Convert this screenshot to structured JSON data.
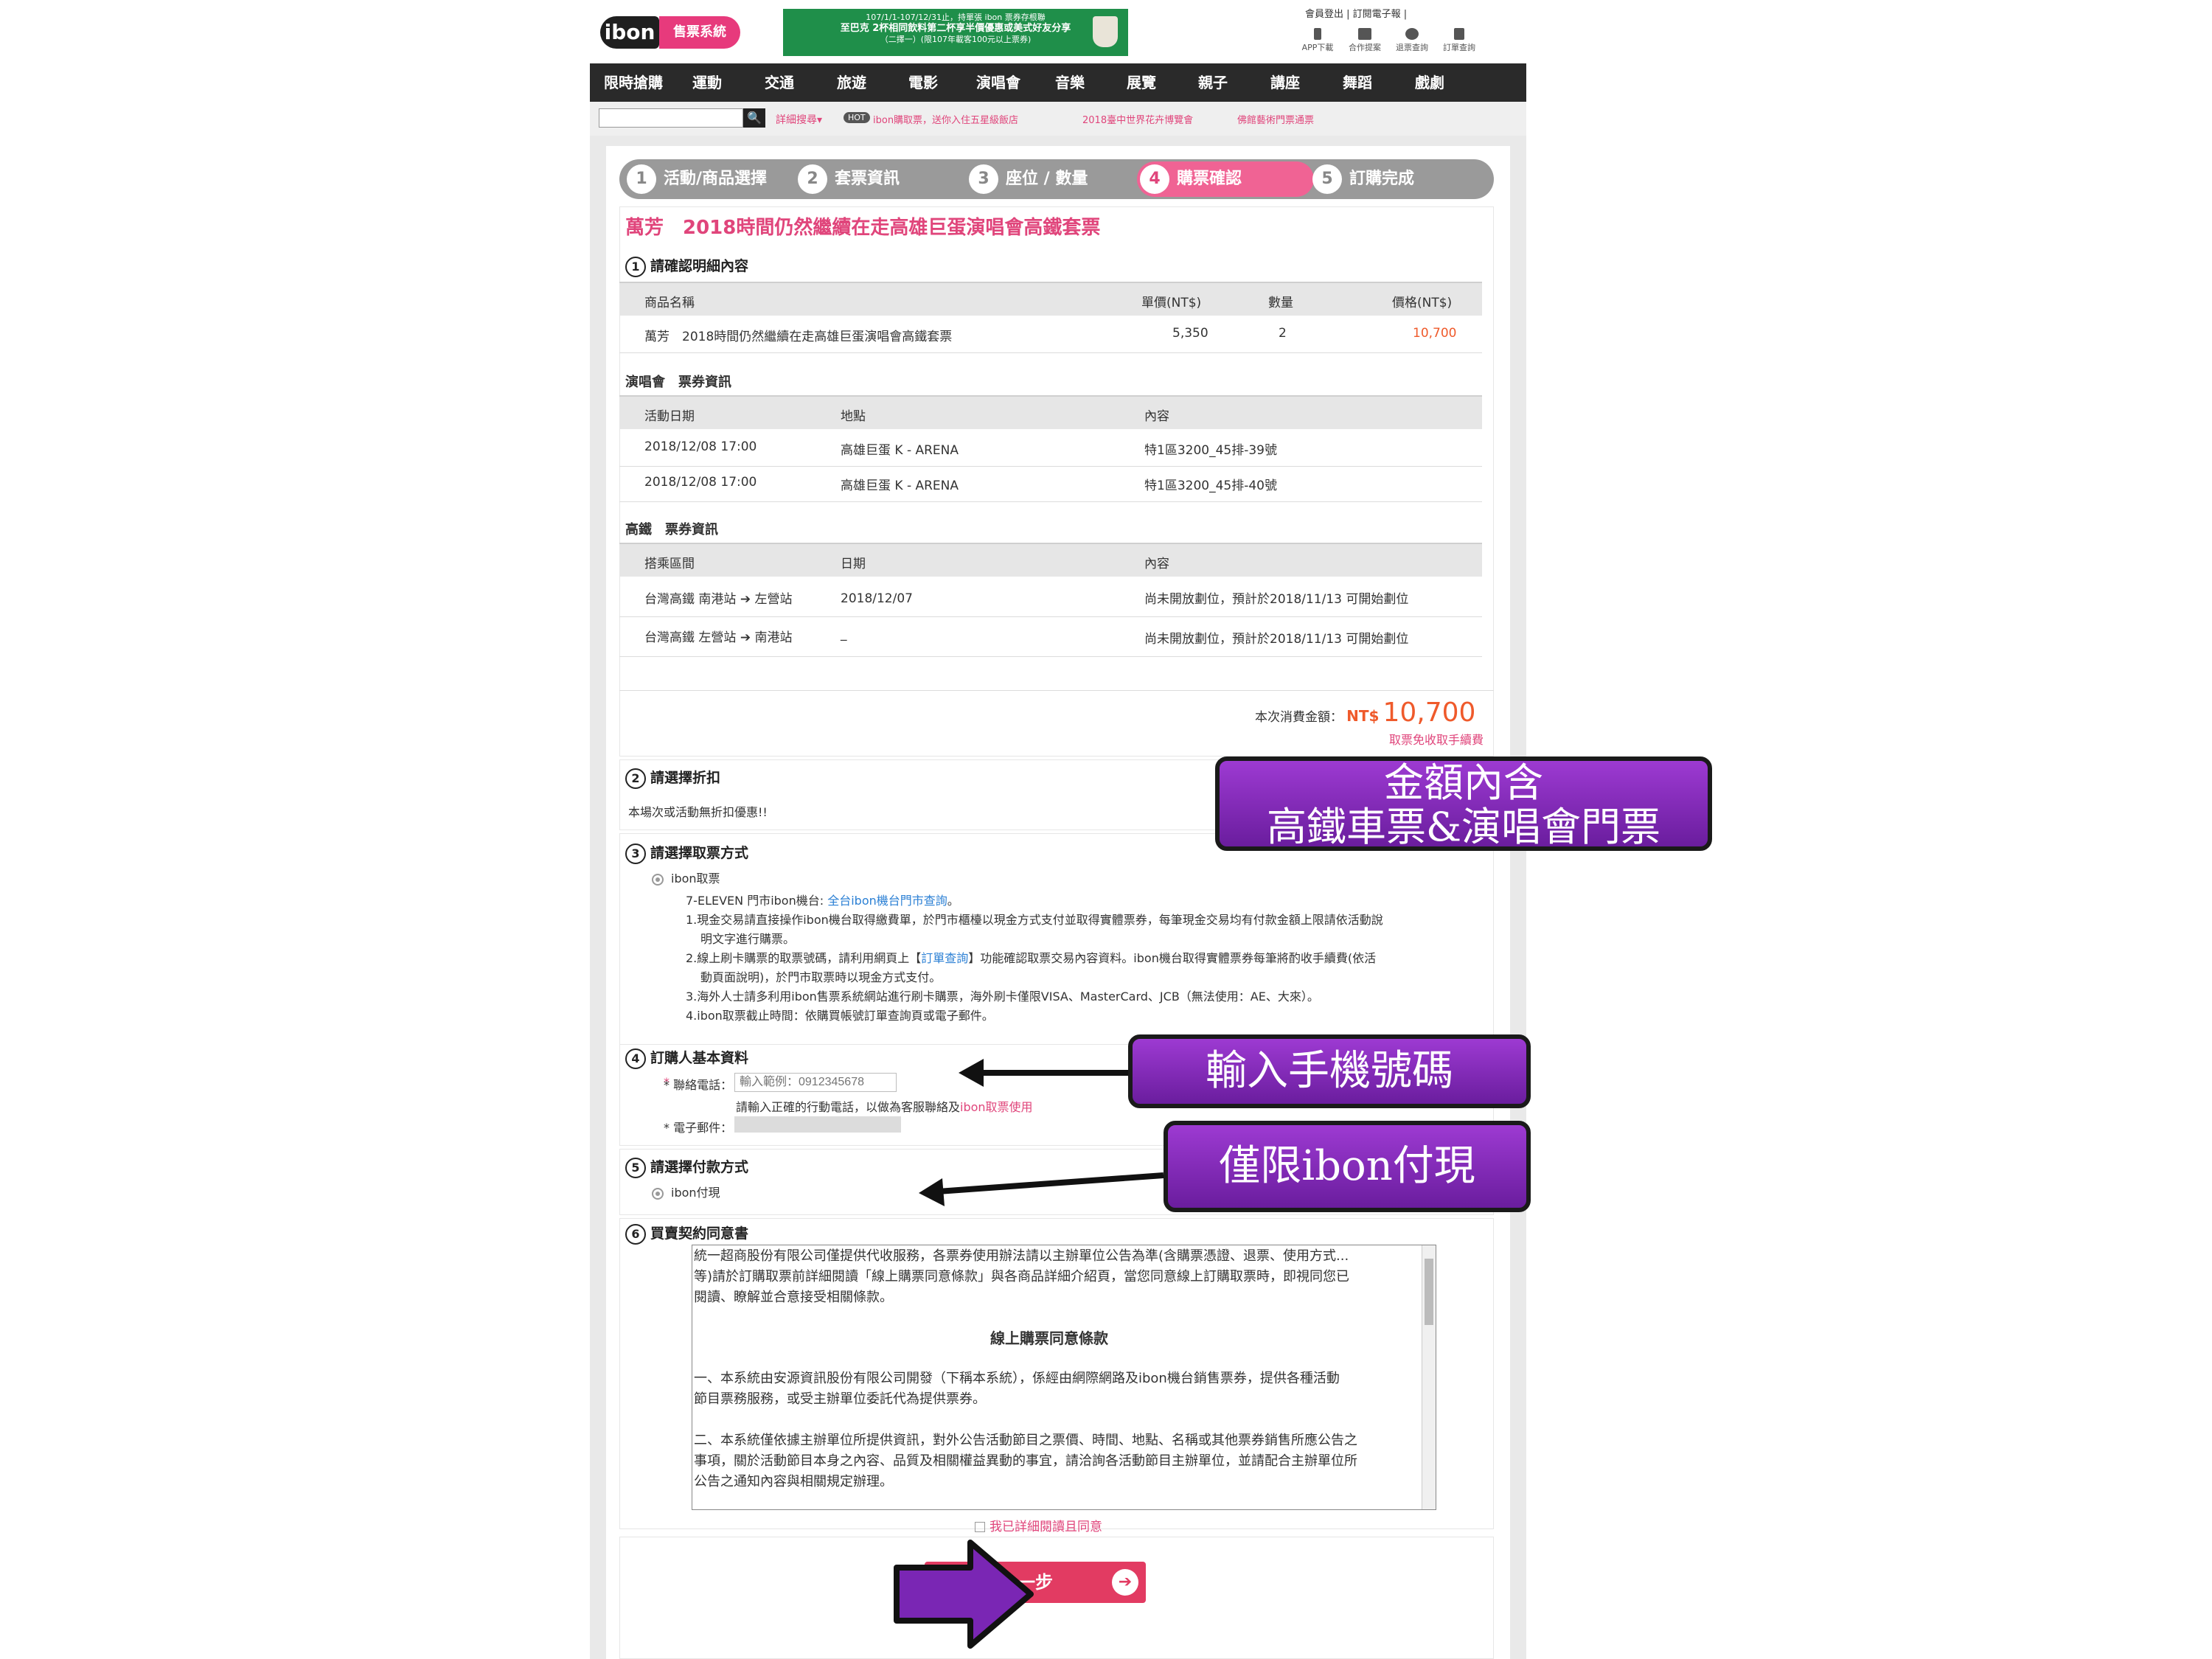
{
  "header": {
    "logo": "ibon",
    "logo_sub": "售票系統",
    "banner": {
      "line1": "107/1/1-107/12/31止，持單張 ibon 票券存根聯",
      "line2": "至巴克 2杯相同飲料第二杯享半價優惠或美式好友分享",
      "line3": "（二擇一）(限107年載客100元以上票券)"
    },
    "top_links": "會員登出 | 訂閱電子報 |",
    "tools": [
      {
        "label": "APP下載",
        "icon": "phone-icon"
      },
      {
        "label": "合作提案",
        "icon": "briefcase-icon"
      },
      {
        "label": "退票查詢",
        "icon": "refund-icon"
      },
      {
        "label": "訂單查詢",
        "icon": "document-icon"
      }
    ]
  },
  "nav": [
    "限時搶購",
    "運動",
    "交通",
    "旅遊",
    "電影",
    "演唱會",
    "音樂",
    "展覽",
    "親子",
    "講座",
    "舞蹈",
    "戲劇"
  ],
  "search": {
    "placeholder": "",
    "button": "🔍",
    "advanced": "詳細搜尋▾",
    "hot_badge": "HOT",
    "hot_links": [
      "ibon購取票，送你入住五星級飯店",
      "2018臺中世界花卉博覽會",
      "佛館藝術門票通票"
    ]
  },
  "steps": [
    {
      "num": "1",
      "label": "活動/商品選擇"
    },
    {
      "num": "2",
      "label": "套票資訊"
    },
    {
      "num": "3",
      "label": "座位 / 數量"
    },
    {
      "num": "4",
      "label": "購票確認"
    },
    {
      "num": "5",
      "label": "訂購完成"
    }
  ],
  "event_title": "萬芳　2018時間仍然繼續在走高雄巨蛋演唱會高鐵套票",
  "section1": {
    "num": "1",
    "title": "請確認明細內容",
    "headers": [
      "商品名稱",
      "單價(NT$)",
      "數量",
      "價格(NT$)"
    ],
    "row": {
      "name": "萬芳　2018時間仍然繼續在走高雄巨蛋演唱會高鐵套票",
      "unit_price": "5,350",
      "qty": "2",
      "price": "10,700"
    }
  },
  "concert": {
    "title": "演唱會　票券資訊",
    "headers": [
      "活動日期",
      "地點",
      "內容"
    ],
    "rows": [
      {
        "date": "2018/12/08 17:00",
        "venue": "高雄巨蛋 K - ARENA",
        "content": "特1區3200_45排-39號"
      },
      {
        "date": "2018/12/08 17:00",
        "venue": "高雄巨蛋 K - ARENA",
        "content": "特1區3200_45排-40號"
      }
    ]
  },
  "hsr": {
    "title": "高鐵　票券資訊",
    "headers": [
      "搭乘區間",
      "日期",
      "內容"
    ],
    "rows": [
      {
        "from": "台灣高鐵 南港站",
        "to": "左營站",
        "date": "2018/12/07",
        "content": "尚未開放劃位，預計於2018/11/13 可開始劃位"
      },
      {
        "from": "台灣高鐵 左營站",
        "to": "南港站",
        "date": "_",
        "content": "尚未開放劃位，預計於2018/11/13 可開始劃位"
      }
    ]
  },
  "total": {
    "label": "本次消費金額：",
    "currency": "NT$",
    "value": "10,700",
    "note": "取票免收取手續費"
  },
  "section2": {
    "num": "2",
    "title": "請選擇折扣",
    "note": "本場次或活動無折扣優惠!!"
  },
  "section3": {
    "num": "3",
    "title": "請選擇取票方式",
    "option": "ibon取票",
    "line0a": "7-ELEVEN 門市ibon機台: ",
    "line0b": "全台ibon機台門市查詢",
    "line0c": "。",
    "line1": "1.現金交易請直接操作ibon機台取得繳費單，於門市櫃檯以現金方式支付並取得實體票券，每筆現金交易均有付款金額上限請依活動說",
    "line1b": "明文字進行購票。",
    "line2a": "2.線上刷卡購票的取票號碼，請利用網頁上【",
    "line2b": "訂單查詢",
    "line2c": "】功能確認取票交易內容資料。ibon機台取得實體票券每筆將酌收手續費(依活",
    "line2d": "動頁面說明)，於門市取票時以現金方式支付。",
    "line3": "3.海外人士請多利用ibon售票系統網站進行刷卡購票，海外刷卡僅限VISA、MasterCard、JCB（無法使用：AE、大來）。",
    "line4": "4.ibon取票截止時間：依購買帳號訂單查詢頁或電子郵件。"
  },
  "section4": {
    "num": "4",
    "title": "訂購人基本資料",
    "phone_label": "* 聯絡電話：",
    "phone_placeholder": "輸入範例：0912345678",
    "phone_hint_a": "請輸入正確的行動電話，以做為客服聯絡及",
    "phone_hint_b": "ibon取票使用",
    "email_label": "* 電子郵件："
  },
  "section5": {
    "num": "5",
    "title": "請選擇付款方式",
    "option": "ibon付現"
  },
  "section6": {
    "num": "6",
    "title": "買賣契約同意書",
    "terms": [
      "統一超商股份有限公司僅提供代收服務，各票券使用辦法請以主辦單位公告為準(含購票憑證、退票、使用方式...",
      "等)請於訂購取票前詳細閱讀「線上購票同意條款」與各商品詳細介紹頁，當您同意線上訂購取票時，即視同您已",
      "閱讀、瞭解並合意接受相關條款。",
      "線上購票同意條款",
      "一、本系統由安源資訊股份有限公司開發（下稱本系統），係經由網際網路及ibon機台銷售票券，提供各種活動",
      "節目票務服務，或受主辦單位委託代為提供票券。",
      "二、本系統僅依據主辦單位所提供資訊，對外公告活動節目之票價、時間、地點、名稱或其他票券銷售所應公告之",
      "事項，關於活動節目本身之內容、品質及相關權益異動的事宜，請洽詢各活動節目主辦單位，並請配合主辦單位所",
      "公告之通知內容與相關規定辦理。"
    ],
    "agree": "我已詳細閱讀且同意"
  },
  "next_button": "一步",
  "annotations": {
    "price_note_line1": "金額內含",
    "price_note_line2": "高鐵車票&演唱會門票",
    "phone_note": "輸入手機號碼",
    "pay_note": "僅限ibon付現"
  },
  "colors": {
    "brand_pink": "#e0457b",
    "price_orange": "#ef5a2b",
    "callout_purple": "#7a26b4",
    "nav_dark": "#2a2a2a"
  }
}
